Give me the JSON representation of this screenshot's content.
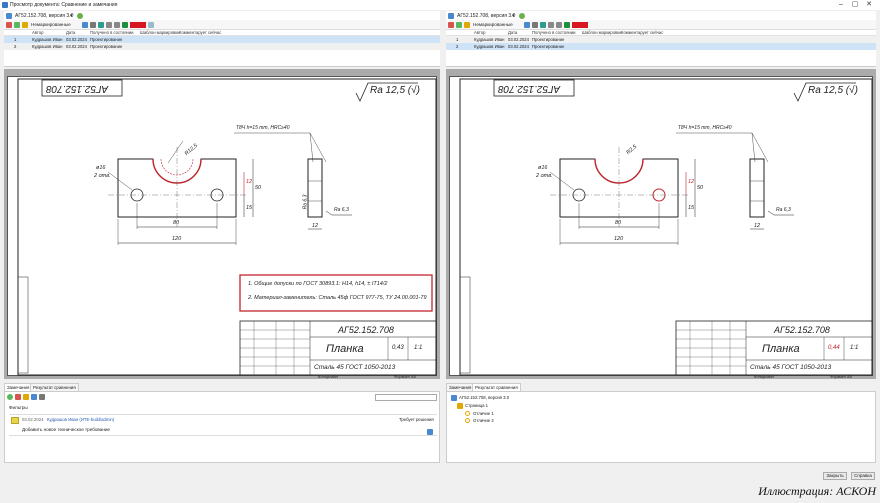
{
  "window": {
    "title": "Просмотр документа: Сравнение и замечания"
  },
  "left": {
    "doc": "АГ52.152.708, версия 3.0",
    "mode": "Немаркированные",
    "cols": [
      "Автор",
      "Дата",
      "Получено в состоянии",
      "Шаблон маркировки",
      "Комментарует сейчас"
    ],
    "rows": [
      {
        "n": "1",
        "author": "Кудрашов Иван",
        "date": "03.02.2024",
        "state": "Проектирование"
      },
      {
        "n": "2",
        "author": "Кудрашов Иван",
        "date": "03.02.2024",
        "state": "Проектирование"
      }
    ]
  },
  "right": {
    "doc": "АГ52.152.708, версия 3.0",
    "mode": "Немаркированные",
    "cols": [
      "Автор",
      "Дата",
      "Получено в состоянии",
      "Шаблон маркировки",
      "Комментарует сейчас"
    ],
    "rows": [
      {
        "n": "1",
        "author": "Кудрашов Иван",
        "date": "03.02.2024",
        "state": "Проектирование"
      },
      {
        "n": "2",
        "author": "Кудрашов Иван",
        "date": "03.02.2024",
        "state": "Проектирование"
      }
    ]
  },
  "drawing": {
    "code": "АГ52.152.708",
    "code_mirror": "АГ52.152.708",
    "roughness": "Ra 12,5 (√)",
    "thread": "Т8Ч h=15 mm, HRC≥40",
    "ra_small": "Ra 6,3",
    "name": "Планка",
    "material": "Сталь 45 ГОСТ 1050-2013",
    "mass_left": "0,43",
    "mass_right": "0,44",
    "scale": "1:1",
    "copied": "Копировал",
    "format": "Формат   А4",
    "dim_80": "80",
    "dim_120": "120",
    "dim_phi": "ø16",
    "dim_2otv": "2 отв.",
    "dim_r": "R12,5",
    "dim_r_right": "R2,5",
    "dim_12": "12",
    "dim_50": "50",
    "dim_15": "15",
    "note1": "1. Общие допуски по ГОСТ 30893.1: H14, h14, ± IT14/2",
    "note2": "2. Материал-заменитель: Сталь 45ф ГОСТ 977-75, ТУ 24.00.001-79"
  },
  "bottom_left": {
    "tabs": [
      "Замечания",
      "Результат сравнения"
    ],
    "filter": "Фильтры",
    "comment_author": "Кудрашов Иван (ИТЕ-build/admin)",
    "comment_date": "03.02.2024",
    "comment_status": "Требует решения",
    "comment_text": "Добавить новое техническое требование"
  },
  "bottom_right": {
    "tabs": [
      "Замечания",
      "Результат сравнения"
    ],
    "tree_root": "АГ52.152.708, версия 3.0",
    "tree_page": "Страница 1",
    "tree_items": [
      "Отличие 1",
      "Отличие 2"
    ]
  },
  "buttons": {
    "close": "Закрыть",
    "help": "Справка"
  },
  "caption": "Иллюстрация: АСКОН",
  "colors": {
    "accent": "#c0262b",
    "selection": "#cfe3f7",
    "bg": "#ababab"
  }
}
